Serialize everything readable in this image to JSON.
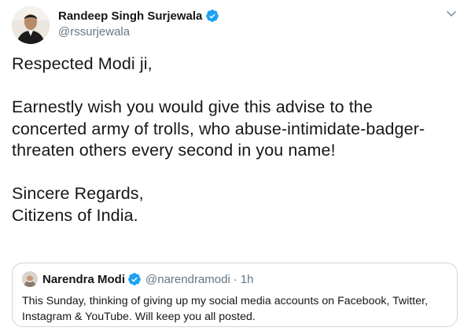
{
  "tweet": {
    "author": {
      "name": "Randeep Singh Surjewala",
      "handle": "@rssurjewala"
    },
    "body_lines": [
      "Respected Modi ji,",
      "",
      "Earnestly wish you would give this advise to the",
      "concerted army of trolls, who abuse-intimidate-badger-",
      "threaten others every second in you name!",
      "",
      "Sincere Regards,",
      "Citizens of India."
    ],
    "quoted": {
      "name": "Narendra Modi",
      "handle": "@narendramodi",
      "separator": "·",
      "time": "1h",
      "text_lines": [
        "This Sunday, thinking of giving up my social media accounts on Facebook, Twitter,",
        "Instagram & YouTube. Will keep you all posted."
      ]
    }
  },
  "icons": {
    "verified": "verified-badge-icon",
    "caret": "chevron-down-icon"
  },
  "colors": {
    "text": "#14171a",
    "secondary": "#657786",
    "verified": "#1da1f2",
    "border": "#ccd6dd"
  }
}
